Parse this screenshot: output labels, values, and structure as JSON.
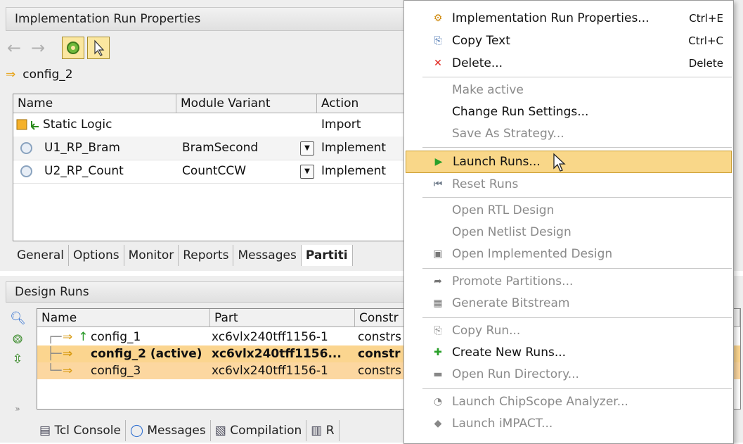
{
  "props": {
    "title": "Implementation Run Properties",
    "config_name": "config_2",
    "columns": [
      "Name",
      "Module Variant",
      "Action"
    ],
    "rows": [
      {
        "name": "Static Logic",
        "variant": "",
        "action": "Import"
      },
      {
        "name": "U1_RP_Bram",
        "variant": "BramSecond",
        "action": "Implement"
      },
      {
        "name": "U2_RP_Count",
        "variant": "CountCCW",
        "action": "Implement"
      }
    ],
    "tabs": [
      "General",
      "Options",
      "Monitor",
      "Reports",
      "Messages",
      "Partiti"
    ],
    "active_tab": "Partiti"
  },
  "runs": {
    "title": "Design Runs",
    "columns": [
      "Name",
      "Part",
      "Constr"
    ],
    "rows": [
      {
        "name": "config_1",
        "part": "xc6vlx240tff1156-1",
        "constr": "constrs"
      },
      {
        "name": "config_2 (active)",
        "part": "xc6vlx240tff1156...",
        "constr": "constr"
      },
      {
        "name": "config_3",
        "part": "xc6vlx240tff1156-1",
        "constr": "constrs"
      }
    ],
    "tabs": [
      "Tcl Console",
      "Messages",
      "Compilation",
      "R"
    ]
  },
  "menu": {
    "items": [
      {
        "label": "Implementation Run Properties...",
        "accel": "Ctrl+E",
        "icon": "properties-icon",
        "disabled": false
      },
      {
        "label": "Copy Text",
        "accel": "Ctrl+C",
        "icon": "copy-icon",
        "disabled": false
      },
      {
        "label": "Delete...",
        "accel": "Delete",
        "icon": "delete-icon",
        "disabled": false
      },
      {
        "label": "Make active",
        "accel": "",
        "icon": "",
        "disabled": true
      },
      {
        "label": "Change Run Settings...",
        "accel": "",
        "icon": "",
        "disabled": false
      },
      {
        "label": "Save As Strategy...",
        "accel": "",
        "icon": "",
        "disabled": true
      },
      {
        "label": "Launch Runs...",
        "accel": "",
        "icon": "launch-icon",
        "disabled": false
      },
      {
        "label": "Reset Runs",
        "accel": "",
        "icon": "reset-icon",
        "disabled": true
      },
      {
        "label": "Open RTL Design",
        "accel": "",
        "icon": "",
        "disabled": true
      },
      {
        "label": "Open Netlist Design",
        "accel": "",
        "icon": "",
        "disabled": true
      },
      {
        "label": "Open Implemented Design",
        "accel": "",
        "icon": "chip-icon",
        "disabled": true
      },
      {
        "label": "Promote Partitions...",
        "accel": "",
        "icon": "promote-icon",
        "disabled": true
      },
      {
        "label": "Generate Bitstream",
        "accel": "",
        "icon": "bitstream-icon",
        "disabled": true
      },
      {
        "label": "Copy Run...",
        "accel": "",
        "icon": "copy-run-icon",
        "disabled": true
      },
      {
        "label": "Create New Runs...",
        "accel": "",
        "icon": "create-runs-icon",
        "disabled": false
      },
      {
        "label": "Open Run Directory...",
        "accel": "",
        "icon": "folder-icon",
        "disabled": true
      },
      {
        "label": "Launch ChipScope Analyzer...",
        "accel": "",
        "icon": "chipscope-icon",
        "disabled": true
      },
      {
        "label": "Launch iMPACT...",
        "accel": "",
        "icon": "impact-icon",
        "disabled": true
      }
    ]
  },
  "colors": {
    "accent": "#f9d789",
    "selected_row": "#fbd58f",
    "disabled_text": "#8a8a8a"
  }
}
